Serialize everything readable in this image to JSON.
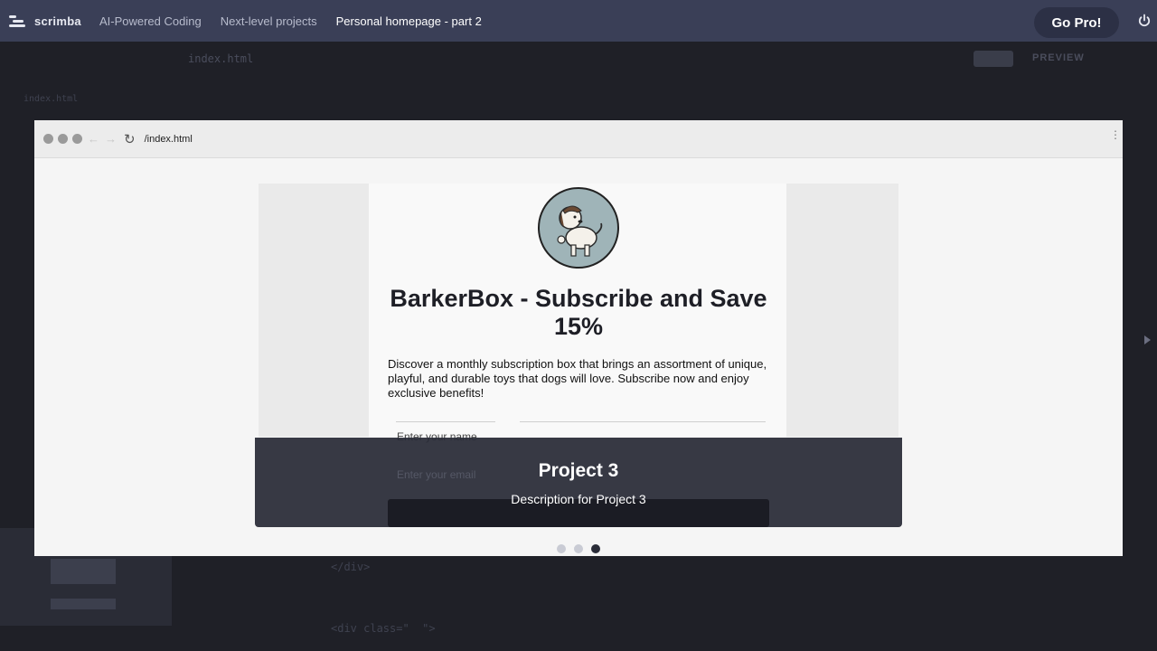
{
  "header": {
    "brand": "scrimba",
    "breadcrumbs": [
      "AI-Powered Coding",
      "Next-level projects",
      "Personal homepage - part 2"
    ],
    "cta": "Go Pro!",
    "power_icon": "power-icon"
  },
  "editor": {
    "file_tab": "index.html",
    "preview_tab": "PREVIEW",
    "sidebar_file": "index.html",
    "code_lines": [
      "</div>",
      "<div class=\"  \">"
    ]
  },
  "browser": {
    "url": "/index.html",
    "card": {
      "headline": "BarkerBox - Subscribe and Save 15%",
      "description": "Discover a monthly subscription box that brings an assortment of unique, playful, and durable toys that dogs will love. Subscribe now and enjoy exclusive benefits!",
      "name_placeholder": "Enter your name",
      "email_placeholder": "Enter your email"
    },
    "overlay": {
      "title": "Project 3",
      "description": "Description for Project 3"
    },
    "pager": {
      "count": 3,
      "active": 3
    }
  },
  "colors": {
    "topbar": "#3a3f57",
    "background": "#1f2027",
    "overlay": "#282a36",
    "accent": "#ffffff"
  }
}
